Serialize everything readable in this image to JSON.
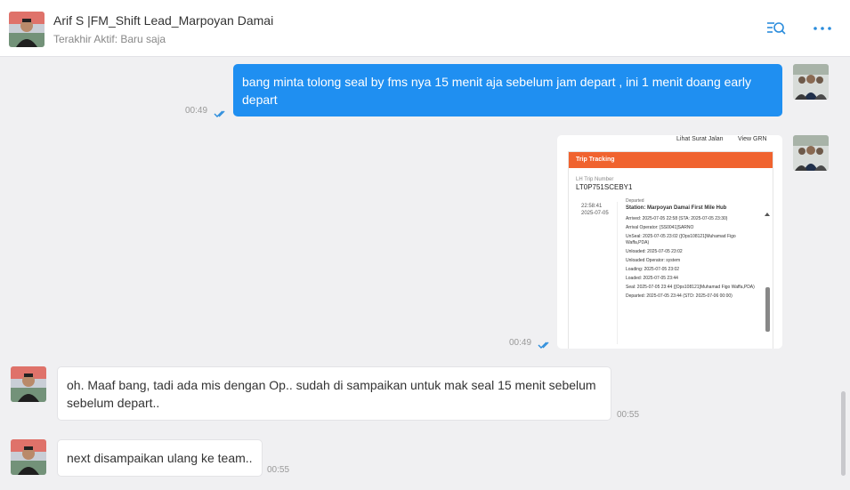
{
  "header": {
    "name": "Arif S |FM_Shift Lead_Marpoyan Damai",
    "status": "Terakhir Aktif: Baru saja"
  },
  "messages": [
    {
      "text": "bang minta tolong seal by fms nya 15 menit aja sebelum jam depart , ini 1 menit doang early depart",
      "time": "00:49"
    },
    {
      "time": "00:49"
    },
    {
      "text": "oh. Maaf bang, tadi ada mis dengan Op.. sudah di sampaikan untuk mak seal 15 menit sebelum sebelum depart..",
      "time": "00:55"
    },
    {
      "text": "next disampaikan ulang ke team..",
      "time": "00:55"
    }
  ],
  "screenshot": {
    "link_surat_jalan": "Lihat Surat Jalan",
    "link_view_grn": "View GRN",
    "title": "Trip Tracking",
    "trip_label": "LH Trip Number",
    "trip_id": "LT0P751SCEBY1",
    "time_top": "22:58:41",
    "date": "2025-07-05",
    "badge": "Departed",
    "station": "Station: Marpoyan Damai First Mile Hub",
    "details": [
      "Arrived: 2025-07-05 22:58 (STA: 2025-07-05 23:30)",
      "Arrival Operator: [SS0041]SARNO",
      "UnSeal: 2025-07-05 23:02 ([Ops108121]Muhamad Figo Waffa,PDA)",
      "Unloaded: 2025-07-05 23:02",
      "Unloaded Operator: system",
      "Loading: 2025-07-05 23:02",
      "Loaded: 2025-07-05 23:44",
      "Seal: 2025-07-05 23:44 ([Ops108121]Muhamad Figo Waffa,PDA)",
      "Departed: 2025-07-05 23:44 (STD: 2025-07-06 00:00)"
    ]
  },
  "colors": {
    "accent": "#1f8ff1",
    "header_orange": "#f0632f"
  },
  "icons": {
    "search": "search-list-icon",
    "more": "more-horizontal-icon",
    "read": "double-check-icon"
  }
}
